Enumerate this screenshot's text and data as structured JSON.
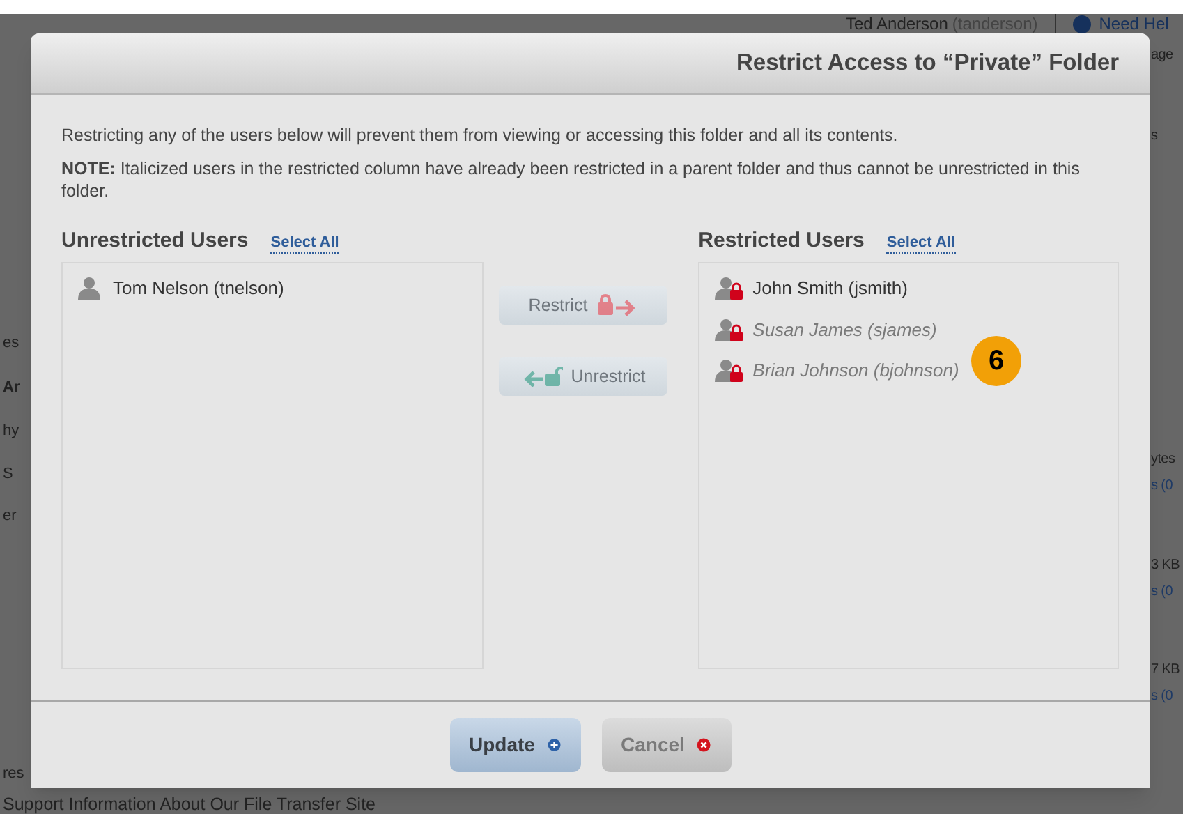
{
  "background_page": {
    "user_name": "Ted Anderson",
    "user_login": "(tanderson)",
    "help_link": "Need Hel",
    "left_fragments": [
      "es",
      "Ar",
      "hy",
      "S",
      "er",
      "res"
    ],
    "right_fragments": [
      "age",
      "s",
      "ytes",
      "s (0",
      "3 KB",
      "s (0",
      "7 KB",
      "s (0"
    ],
    "footer_link": "Support Information About Our File Transfer Site"
  },
  "dialog": {
    "title": "Restrict Access to “Private” Folder",
    "intro": "Restricting any of the users below will prevent them from viewing or accessing this folder and all its contents.",
    "note": "**NOTE:** Italicized users in the restricted column have already been restricted in a parent folder and thus cannot be unrestricted in this folder.",
    "unrestricted": {
      "heading": "Unrestricted Users",
      "select_all": "Select All",
      "users": [
        {
          "name": "Tom Nelson (tnelson)",
          "inherited": false
        }
      ]
    },
    "restricted": {
      "heading": "Restricted Users",
      "select_all": "Select All",
      "users": [
        {
          "name": "John Smith (jsmith)",
          "inherited": false
        },
        {
          "name": "Susan James (sjames)",
          "inherited": true
        },
        {
          "name": "Brian Johnson (bjohnson)",
          "inherited": true
        }
      ]
    },
    "restrict_button": {
      "label": "Restrict",
      "disabled": true
    },
    "unrestrict_button": {
      "label": "Unrestrict",
      "disabled": true
    },
    "buttons": [
      {
        "label": "Update",
        "kind": "primary"
      },
      {
        "label": "Cancel",
        "kind": "cancel"
      }
    ]
  },
  "annotation": {
    "text": "6"
  }
}
